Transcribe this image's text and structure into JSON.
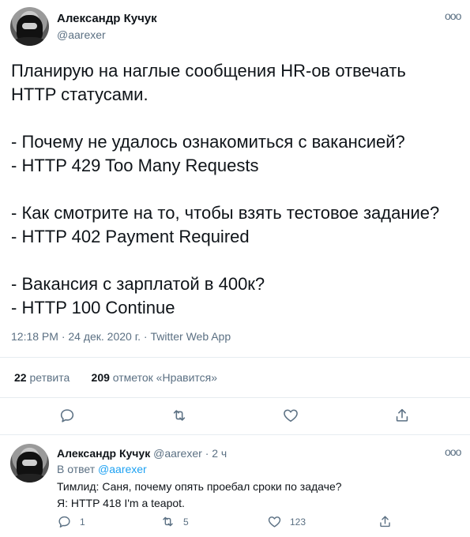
{
  "tweet": {
    "author_name": "Александр Кучук",
    "author_handle": "@aarexer",
    "more_label": "ооо",
    "lines": [
      "Планирую на наглые сообщения HR-ов отвечать",
      "HTTP статусами.",
      "",
      "- Почему не удалось ознакомиться с вакансией?",
      "- HTTP 429 Too Many Requests",
      "",
      "- Как смотрите на то, чтобы взять тестовое задание?",
      "- HTTP 402 Payment Required",
      "",
      "- Вакансия с зарплатой в 400к?",
      "- HTTP 100 Continue"
    ],
    "meta": "12:18 PM · 24 дек. 2020 г. · Twitter Web App",
    "retweets_count": "22",
    "retweets_label": "ретвита",
    "likes_count": "209",
    "likes_label": "отметок «Нравится»"
  },
  "icons": {
    "reply": "comment-icon",
    "retweet": "retweet-icon",
    "like": "heart-icon",
    "share": "share-icon"
  },
  "reply": {
    "author_name": "Александр Кучук",
    "author_handle": "@aarexer",
    "time": "· 2 ч",
    "more_label": "ооо",
    "reply_to_prefix": "В ответ",
    "reply_to_handle": "@aarexer",
    "line1": "Тимлид: Саня, почему опять проебал сроки по задаче?",
    "line2": "Я: HTTP 418 I'm a teapot.",
    "replies": "1",
    "retweets": "5",
    "likes": "123"
  },
  "colors": {
    "text": "#0f1419",
    "secondary": "#5b7083",
    "link": "#1da1f2",
    "divider": "#e6ecf0"
  }
}
